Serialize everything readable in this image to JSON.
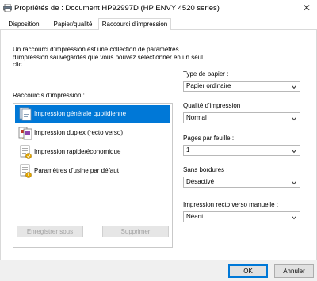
{
  "window": {
    "title": "Propriétés de : Document HP92997D (HP ENVY 4520 series)",
    "app_icon": "printer-icon",
    "close_glyph": "✕"
  },
  "tabs": [
    {
      "label": "Disposition",
      "active": false
    },
    {
      "label": "Papier/qualité",
      "active": false
    },
    {
      "label": "Raccourci d'impression",
      "active": true
    }
  ],
  "description": "Un raccourci d'impression est une collection de paramètres d'impression sauvegardés que vous pouvez sélectionner en un seul clic.",
  "shortcuts": {
    "label": "Raccourcis d'impression :",
    "items": [
      {
        "label": "Impression générale quotidienne",
        "selected": true,
        "icon": "document-stack-icon"
      },
      {
        "label": "Impression duplex (recto verso)",
        "selected": false,
        "icon": "duplex-doc-icon"
      },
      {
        "label": "Impression rapide/économique",
        "selected": false,
        "icon": "economy-doc-icon"
      },
      {
        "label": "Paramètres d'usine par défaut",
        "selected": false,
        "icon": "factory-doc-icon"
      }
    ]
  },
  "buttons": {
    "save": "Enregistrer sous",
    "delete": "Supprimer",
    "ok": "OK",
    "cancel": "Annuler"
  },
  "settings": {
    "paper_type": {
      "label": "Type de papier :",
      "value": "Papier ordinaire"
    },
    "quality": {
      "label": "Qualité d'impression :",
      "value": "Normal"
    },
    "pages_per_sheet": {
      "label": "Pages par feuille :",
      "value": "1"
    },
    "borderless": {
      "label": "Sans bordures :",
      "value": "Désactivé"
    },
    "manual_duplex": {
      "label": "Impression recto verso manuelle :",
      "value": "Néant"
    }
  },
  "colors": {
    "accent": "#0078d7",
    "selection_text": "#ffffff"
  }
}
